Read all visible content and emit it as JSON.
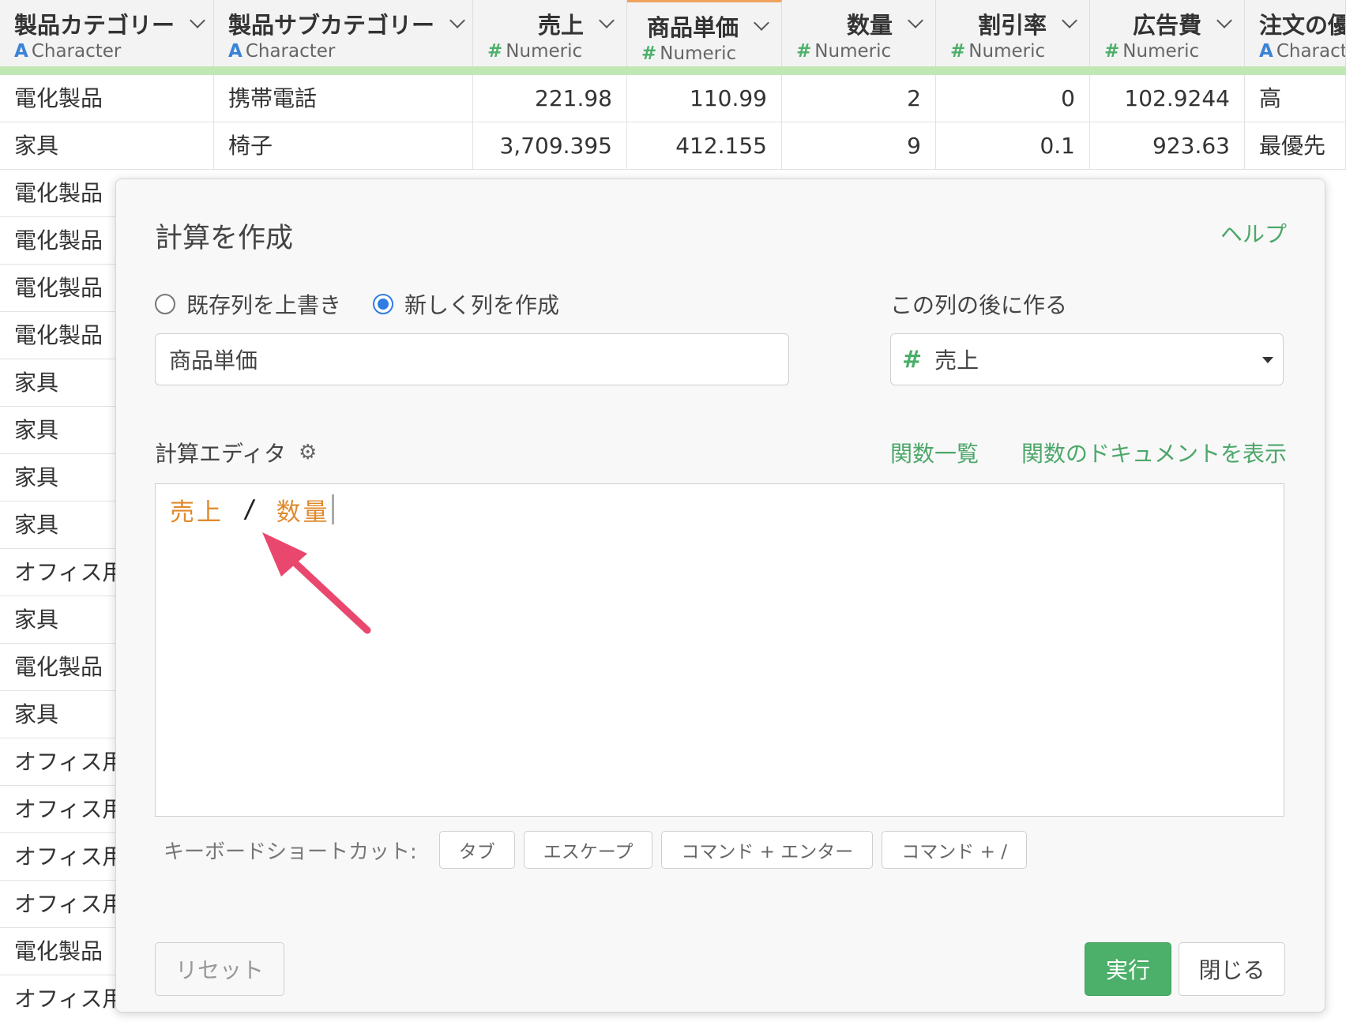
{
  "grid": {
    "columns": [
      {
        "name": "製品カテゴリー",
        "type": "Character",
        "kind": "char",
        "align": "left",
        "active": false
      },
      {
        "name": "製品サブカテゴリー",
        "type": "Character",
        "kind": "char",
        "align": "left",
        "active": false
      },
      {
        "name": "売上",
        "type": "Numeric",
        "kind": "num",
        "align": "right",
        "active": false
      },
      {
        "name": "商品単価",
        "type": "Numeric",
        "kind": "num",
        "align": "right",
        "active": true
      },
      {
        "name": "数量",
        "type": "Numeric",
        "kind": "num",
        "align": "right",
        "active": false
      },
      {
        "name": "割引率",
        "type": "Numeric",
        "kind": "num",
        "align": "right",
        "active": false
      },
      {
        "name": "広告費",
        "type": "Numeric",
        "kind": "num",
        "align": "right",
        "active": false
      },
      {
        "name": "注文の優",
        "type": "Charact",
        "kind": "char",
        "align": "left",
        "active": false
      }
    ],
    "type_icons": {
      "char": "A",
      "num": "#"
    },
    "rows": [
      [
        "電化製品",
        "携帯電話",
        "221.98",
        "110.99",
        "2",
        "0",
        "102.9244",
        "高"
      ],
      [
        "家具",
        "椅子",
        "3,709.395",
        "412.155",
        "9",
        "0.1",
        "923.63",
        "最優先"
      ]
    ],
    "left_column_rest": [
      "電化製品",
      "電化製品",
      "電化製品",
      "電化製品",
      "家具",
      "家具",
      "家具",
      "家具",
      "オフィス用",
      "家具",
      "電化製品",
      "家具",
      "オフィス用",
      "オフィス用",
      "オフィス用",
      "オフィス用",
      "電化製品",
      "オフィス用"
    ]
  },
  "dialog": {
    "title": "計算を作成",
    "help_link": "ヘルプ",
    "radio_overwrite": "既存列を上書き",
    "radio_new": "新しく列を作成",
    "selected_mode": "new",
    "after_column_label": "この列の後に作る",
    "column_name_value": "商品単価",
    "after_column_value": "売上",
    "after_column_type_icon": "#",
    "editor_label": "計算エディタ",
    "settings_icon": "gear-icon",
    "function_list_link": "関数一覧",
    "function_docs_link": "関数のドキュメントを表示",
    "expression": {
      "left": "売上",
      "operator": "/",
      "right": "数量"
    },
    "shortcuts_label": "キーボードショートカット:",
    "shortcuts": [
      "タブ",
      "エスケープ",
      "コマンド + エンター",
      "コマンド + /"
    ],
    "reset_button": "リセット",
    "run_button": "実行",
    "close_button": "閉じる"
  },
  "annotation": {
    "arrow_color": "#e9476e"
  },
  "colors": {
    "accent_green": "#4caf6a",
    "column_token": "#e08a2e",
    "char_type": "#3b83d6",
    "active_column": "#f0a35c",
    "header_bar": "#bfe8b5"
  }
}
